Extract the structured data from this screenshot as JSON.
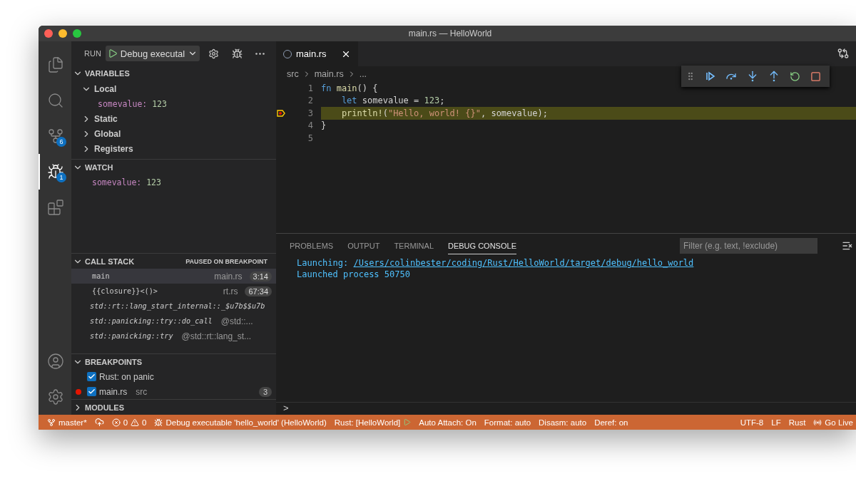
{
  "window": {
    "title": "main.rs — HelloWorld"
  },
  "activity_bar": {
    "items": [
      {
        "kind": "files",
        "selected": false
      },
      {
        "kind": "search",
        "selected": false
      },
      {
        "kind": "source-control",
        "selected": false,
        "badge": "6"
      },
      {
        "kind": "debug",
        "selected": true,
        "badge": "1"
      },
      {
        "kind": "extensions",
        "selected": false
      }
    ],
    "bottom": [
      {
        "kind": "account"
      },
      {
        "kind": "settings"
      }
    ]
  },
  "run_header": {
    "label": "RUN",
    "configuration": "Debug executal"
  },
  "variables": {
    "title": "VARIABLES",
    "expanded": true,
    "items": [
      {
        "label": "Local",
        "expanded": true,
        "children": [
          {
            "name": "somevalue:",
            "value": "123"
          }
        ]
      },
      {
        "label": "Static",
        "expanded": false
      },
      {
        "label": "Global",
        "expanded": false
      },
      {
        "label": "Registers",
        "expanded": false
      }
    ]
  },
  "watch": {
    "title": "WATCH",
    "expanded": true,
    "items": [
      {
        "name": "somevalue:",
        "value": "123"
      }
    ]
  },
  "call_stack": {
    "title": "CALL STACK",
    "status": "PAUSED ON BREAKPOINT",
    "expanded": true,
    "frames": [
      {
        "kind": "user",
        "name": "main",
        "source": "main.rs",
        "position": "3:14",
        "selected": true
      },
      {
        "kind": "user",
        "name": "{{closure}}<()>",
        "source": "rt.rs",
        "position": "67:34",
        "selected": false
      },
      {
        "kind": "library",
        "name": "std::rt::lang_start_internal::_$u7b$$u7b",
        "selected": false
      },
      {
        "kind": "library",
        "name": "std::panicking::try::do_call",
        "source": "@std::...",
        "selected": false
      },
      {
        "kind": "library",
        "name": "std::panicking::try",
        "source": "@std::rt::lang_st...",
        "selected": false
      }
    ]
  },
  "breakpoints": {
    "title": "BREAKPOINTS",
    "expanded": true,
    "items": [
      {
        "kind": "exception",
        "label": "Rust: on panic",
        "checked": true
      },
      {
        "kind": "source",
        "label": "main.rs",
        "detail": "src",
        "count": "3",
        "checked": true
      }
    ]
  },
  "modules": {
    "title": "MODULES",
    "expanded": false
  },
  "editor": {
    "tabs": [
      {
        "label": "main.rs",
        "selected": true
      }
    ],
    "breadcrumbs": [
      "src",
      "main.rs",
      "..."
    ],
    "lines": [
      {
        "number": "1",
        "current": false,
        "indented": false,
        "tokens": [
          {
            "kind": "keyword",
            "text": "fn "
          },
          {
            "kind": "function",
            "text": "main"
          },
          {
            "kind": "plain",
            "text": "() {"
          }
        ]
      },
      {
        "number": "2",
        "current": false,
        "indented": true,
        "tokens": [
          {
            "kind": "keyword",
            "text": "let "
          },
          {
            "kind": "plain",
            "text": "somevalue = "
          },
          {
            "kind": "number",
            "text": "123"
          },
          {
            "kind": "plain",
            "text": ";"
          }
        ]
      },
      {
        "number": "3",
        "current": true,
        "indented": true,
        "tokens": [
          {
            "kind": "function",
            "text": "println!"
          },
          {
            "kind": "plain",
            "text": "("
          },
          {
            "kind": "string",
            "text": "\"Hello, world! {}\""
          },
          {
            "kind": "plain",
            "text": ", somevalue);"
          }
        ]
      },
      {
        "number": "4",
        "current": false,
        "indented": false,
        "tokens": [
          {
            "kind": "plain",
            "text": "}"
          }
        ]
      },
      {
        "number": "5"
      }
    ]
  },
  "debug_toolbar": [
    {
      "kind": "continue"
    },
    {
      "kind": "step-over"
    },
    {
      "kind": "step-into"
    },
    {
      "kind": "step-out"
    },
    {
      "kind": "restart"
    },
    {
      "kind": "stop"
    }
  ],
  "panel": {
    "tabs": [
      {
        "label": "PROBLEMS",
        "selected": false
      },
      {
        "label": "OUTPUT",
        "selected": false
      },
      {
        "label": "TERMINAL",
        "selected": false
      },
      {
        "label": "DEBUG CONSOLE",
        "selected": true
      }
    ],
    "filter": {
      "placeholder": "Filter (e.g. text, !exclude)"
    },
    "console": [
      {
        "prefix": "Launching: ",
        "link": "/Users/colinbester/coding/Rust/HelloWorld/target/debug/hello_world"
      },
      {
        "prefix": "Launched process 50750"
      }
    ],
    "prompt": ">"
  },
  "status_bar": {
    "branch": "master*",
    "errors": "0",
    "warnings": "0",
    "debug_session": "Debug executable 'hello_world' (HelloWorld)",
    "items": [
      "Rust: [HelloWorld]",
      "Auto Attach: On",
      "Format: auto",
      "Disasm: auto",
      "Deref: on"
    ],
    "right": [
      "UTF-8",
      "LF",
      "Rust"
    ],
    "live": "Go Live"
  }
}
